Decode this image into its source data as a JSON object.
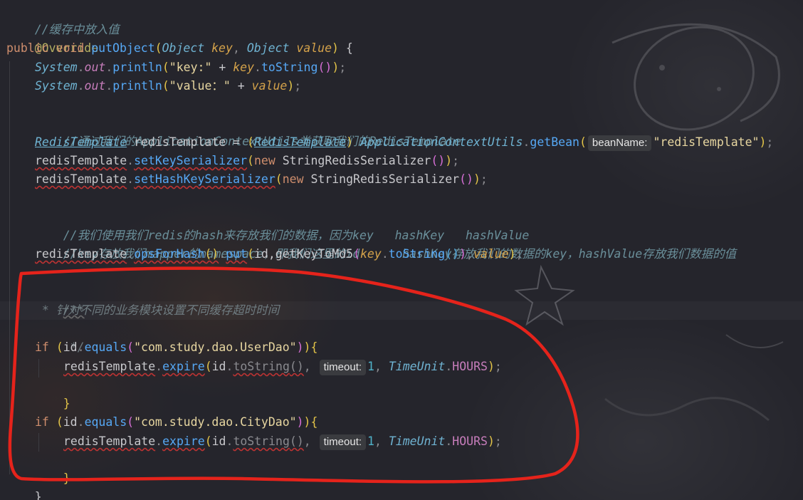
{
  "code": {
    "l1_comment": "//缓存中放入值",
    "l2_annotation": "@Override",
    "l3": {
      "kw_public": "public",
      "kw_void": "void",
      "method": "putObject",
      "p_open": "(",
      "type1": "Object",
      "param1": "key",
      "comma": ", ",
      "type2": "Object",
      "param2": "value",
      "p_close": ")",
      "brace": " {"
    },
    "l4": {
      "cls": "System",
      "dot1": ".",
      "fld": "out",
      "dot2": ".",
      "method": "println",
      "p_open": "(",
      "str": "\"key:\"",
      "plus": " + ",
      "param": "key",
      "dot3": ".",
      "call": "toString",
      "p_inner": "()",
      "p_close": ")",
      "semi": ";"
    },
    "l5": {
      "cls": "System",
      "dot1": ".",
      "fld": "out",
      "dot2": ".",
      "method": "println",
      "p_open": "(",
      "str": "\"value：\"",
      "plus": " + ",
      "param": "value",
      "p_close": ")",
      "semi": ";"
    },
    "l7_comment": "//通过我们的ApplicationContextUtils类获取我们的RedisTemplate",
    "l8": {
      "type": "RedisTemplate",
      "var": " redisTemplate = ",
      "p_open": "(",
      "cast": "RedisTemplate",
      "p_close": ")",
      "sp": " ",
      "cls": "ApplicationContextUtils",
      "dot": ".",
      "method": "getBean",
      "call_open": "(",
      "hint": "beanName:",
      "str": "\"redisTemplate\"",
      "call_close": ")",
      "semi": ";"
    },
    "l9": {
      "var": "redisTemplate",
      "dot": ".",
      "method": "setKeySerializer",
      "p_open": "(",
      "kw_new": "new",
      "cls": " StringRedisSerializer",
      "p_inner": "()",
      "p_close": ")",
      "semi": ";"
    },
    "l10": {
      "var": "redisTemplate",
      "dot": ".",
      "method": "setHashKeySerializer",
      "p_open": "(",
      "kw_new": "new",
      "cls": " StringRedisSerializer",
      "p_inner": "()",
      "p_close": ")",
      "semi": ";"
    },
    "l12_comment": "//我们使用我们redis的hash来存放我们的数据，因为key   hashKey   hashValue",
    "l13_comment": "//key存放我们mapper的namespace，即我们这里的id      hashKey存放我们的数据的key，hashValue存放我们数据的值",
    "l14": {
      "var": "redisTemplate",
      "dot1": ".",
      "method1": "opsForHash",
      "p1": "()",
      "dot2": ".",
      "method2": "put",
      "p_open": "(",
      "arg1": "id,getKeyToMd5",
      "p2_open": "(",
      "param1": "key",
      "dot3": ".",
      "call": "toString",
      "p3": "()",
      "p2_close": ")",
      "comma": ",",
      "param2": "value",
      "p_close": ")",
      "semi": ";"
    },
    "l16_doc": "/**",
    "l17_doc": " * 针对不同的业务模块设置不同缓存超时时间",
    "l18_doc": " */",
    "l19": {
      "kw_if": "if",
      "sp": " ",
      "p_open": "(",
      "var": "id",
      "dot": ".",
      "method": "equals",
      "p2_open": "(",
      "str": "\"com.study.dao.UserDao\"",
      "p2_close": ")",
      "p_close": ")",
      "brace": "{"
    },
    "l20": {
      "var": "redisTemplate",
      "dot": ".",
      "method": "expire",
      "p_open": "(",
      "arg": "id",
      "dot2": ".",
      "call": "toString",
      "p_inner": "()",
      "comma": ", ",
      "hint": "timeout:",
      "num": "1",
      "comma2": ", ",
      "cls": "TimeUnit",
      "dot3": ".",
      "fld": "HOURS",
      "p_close": ")",
      "semi": ";"
    },
    "l21_brace": "}",
    "l23": {
      "kw_if": "if",
      "sp": " ",
      "p_open": "(",
      "var": "id",
      "dot": ".",
      "method": "equals",
      "p2_open": "(",
      "str": "\"com.study.dao.CityDao\"",
      "p2_close": ")",
      "p_close": ")",
      "brace": "{"
    },
    "l24": {
      "var": "redisTemplate",
      "dot": ".",
      "method": "expire",
      "p_open": "(",
      "arg": "id",
      "dot2": ".",
      "call": "toString",
      "p_inner": "()",
      "comma": ", ",
      "hint": "timeout:",
      "num": "1",
      "comma2": ", ",
      "cls": "TimeUnit",
      "dot3": ".",
      "fld": "HOURS",
      "p_close": ")",
      "semi": ";"
    },
    "l25_brace": "}",
    "l26_brace": "}"
  },
  "colors": {
    "highlight_ink": "#e5231b",
    "background": "#25252c"
  }
}
